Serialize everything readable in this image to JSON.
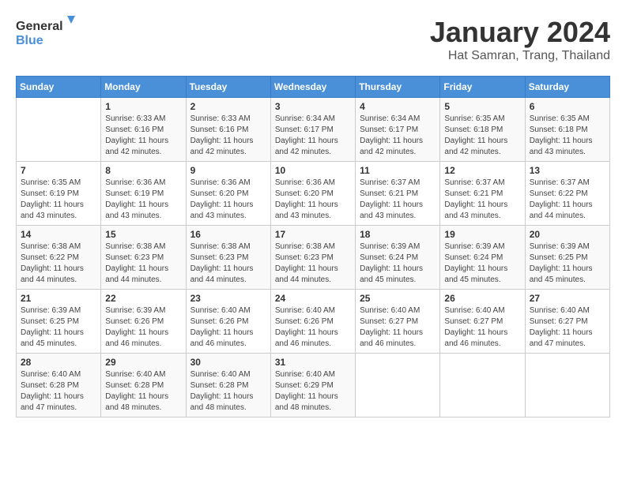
{
  "logo": {
    "general": "General",
    "blue": "Blue"
  },
  "header": {
    "month": "January 2024",
    "location": "Hat Samran, Trang, Thailand"
  },
  "days_of_week": [
    "Sunday",
    "Monday",
    "Tuesday",
    "Wednesday",
    "Thursday",
    "Friday",
    "Saturday"
  ],
  "weeks": [
    [
      {
        "day": "",
        "info": ""
      },
      {
        "day": "1",
        "info": "Sunrise: 6:33 AM\nSunset: 6:16 PM\nDaylight: 11 hours\nand 42 minutes."
      },
      {
        "day": "2",
        "info": "Sunrise: 6:33 AM\nSunset: 6:16 PM\nDaylight: 11 hours\nand 42 minutes."
      },
      {
        "day": "3",
        "info": "Sunrise: 6:34 AM\nSunset: 6:17 PM\nDaylight: 11 hours\nand 42 minutes."
      },
      {
        "day": "4",
        "info": "Sunrise: 6:34 AM\nSunset: 6:17 PM\nDaylight: 11 hours\nand 42 minutes."
      },
      {
        "day": "5",
        "info": "Sunrise: 6:35 AM\nSunset: 6:18 PM\nDaylight: 11 hours\nand 42 minutes."
      },
      {
        "day": "6",
        "info": "Sunrise: 6:35 AM\nSunset: 6:18 PM\nDaylight: 11 hours\nand 43 minutes."
      }
    ],
    [
      {
        "day": "7",
        "info": "Sunrise: 6:35 AM\nSunset: 6:19 PM\nDaylight: 11 hours\nand 43 minutes."
      },
      {
        "day": "8",
        "info": "Sunrise: 6:36 AM\nSunset: 6:19 PM\nDaylight: 11 hours\nand 43 minutes."
      },
      {
        "day": "9",
        "info": "Sunrise: 6:36 AM\nSunset: 6:20 PM\nDaylight: 11 hours\nand 43 minutes."
      },
      {
        "day": "10",
        "info": "Sunrise: 6:36 AM\nSunset: 6:20 PM\nDaylight: 11 hours\nand 43 minutes."
      },
      {
        "day": "11",
        "info": "Sunrise: 6:37 AM\nSunset: 6:21 PM\nDaylight: 11 hours\nand 43 minutes."
      },
      {
        "day": "12",
        "info": "Sunrise: 6:37 AM\nSunset: 6:21 PM\nDaylight: 11 hours\nand 43 minutes."
      },
      {
        "day": "13",
        "info": "Sunrise: 6:37 AM\nSunset: 6:22 PM\nDaylight: 11 hours\nand 44 minutes."
      }
    ],
    [
      {
        "day": "14",
        "info": "Sunrise: 6:38 AM\nSunset: 6:22 PM\nDaylight: 11 hours\nand 44 minutes."
      },
      {
        "day": "15",
        "info": "Sunrise: 6:38 AM\nSunset: 6:23 PM\nDaylight: 11 hours\nand 44 minutes."
      },
      {
        "day": "16",
        "info": "Sunrise: 6:38 AM\nSunset: 6:23 PM\nDaylight: 11 hours\nand 44 minutes."
      },
      {
        "day": "17",
        "info": "Sunrise: 6:38 AM\nSunset: 6:23 PM\nDaylight: 11 hours\nand 44 minutes."
      },
      {
        "day": "18",
        "info": "Sunrise: 6:39 AM\nSunset: 6:24 PM\nDaylight: 11 hours\nand 45 minutes."
      },
      {
        "day": "19",
        "info": "Sunrise: 6:39 AM\nSunset: 6:24 PM\nDaylight: 11 hours\nand 45 minutes."
      },
      {
        "day": "20",
        "info": "Sunrise: 6:39 AM\nSunset: 6:25 PM\nDaylight: 11 hours\nand 45 minutes."
      }
    ],
    [
      {
        "day": "21",
        "info": "Sunrise: 6:39 AM\nSunset: 6:25 PM\nDaylight: 11 hours\nand 45 minutes."
      },
      {
        "day": "22",
        "info": "Sunrise: 6:39 AM\nSunset: 6:26 PM\nDaylight: 11 hours\nand 46 minutes."
      },
      {
        "day": "23",
        "info": "Sunrise: 6:40 AM\nSunset: 6:26 PM\nDaylight: 11 hours\nand 46 minutes."
      },
      {
        "day": "24",
        "info": "Sunrise: 6:40 AM\nSunset: 6:26 PM\nDaylight: 11 hours\nand 46 minutes."
      },
      {
        "day": "25",
        "info": "Sunrise: 6:40 AM\nSunset: 6:27 PM\nDaylight: 11 hours\nand 46 minutes."
      },
      {
        "day": "26",
        "info": "Sunrise: 6:40 AM\nSunset: 6:27 PM\nDaylight: 11 hours\nand 46 minutes."
      },
      {
        "day": "27",
        "info": "Sunrise: 6:40 AM\nSunset: 6:27 PM\nDaylight: 11 hours\nand 47 minutes."
      }
    ],
    [
      {
        "day": "28",
        "info": "Sunrise: 6:40 AM\nSunset: 6:28 PM\nDaylight: 11 hours\nand 47 minutes."
      },
      {
        "day": "29",
        "info": "Sunrise: 6:40 AM\nSunset: 6:28 PM\nDaylight: 11 hours\nand 48 minutes."
      },
      {
        "day": "30",
        "info": "Sunrise: 6:40 AM\nSunset: 6:28 PM\nDaylight: 11 hours\nand 48 minutes."
      },
      {
        "day": "31",
        "info": "Sunrise: 6:40 AM\nSunset: 6:29 PM\nDaylight: 11 hours\nand 48 minutes."
      },
      {
        "day": "",
        "info": ""
      },
      {
        "day": "",
        "info": ""
      },
      {
        "day": "",
        "info": ""
      }
    ]
  ]
}
